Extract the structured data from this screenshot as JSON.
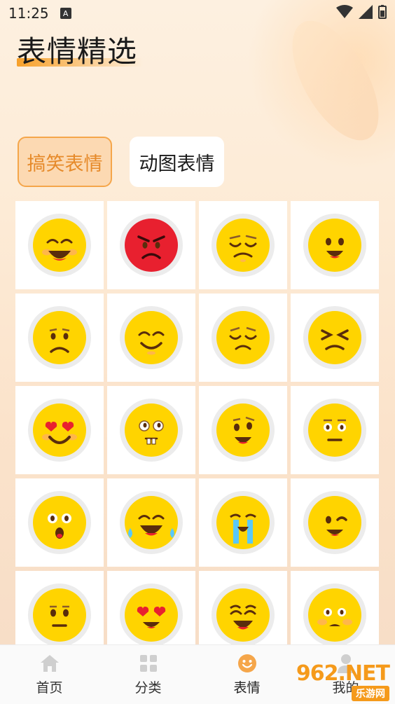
{
  "status_bar": {
    "time": "11:25",
    "notification_icon": "A"
  },
  "page": {
    "title": "表情精选"
  },
  "tabs": [
    {
      "label": "搞笑表情",
      "active": true
    },
    {
      "label": "动图表情",
      "active": false
    }
  ],
  "emojis": [
    "grinning-blush",
    "angry-red",
    "annoyed",
    "happy-open",
    "sad",
    "content-smile",
    "worried",
    "squinting-upset",
    "heart-eyes-grin",
    "buck-tooth",
    "smirk-grin",
    "neutral-raised",
    "surprised",
    "tears-of-joy",
    "loudly-crying",
    "wink",
    "neutral",
    "heart-eyes",
    "big-grin",
    "flushed"
  ],
  "bottom_nav": [
    {
      "label": "首页",
      "icon": "home-icon"
    },
    {
      "label": "分类",
      "icon": "grid-icon"
    },
    {
      "label": "表情",
      "icon": "smile-icon",
      "active": true
    },
    {
      "label": "我的",
      "icon": "user-icon"
    }
  ],
  "watermark": {
    "top": "962.NET",
    "bottom": "乐游网"
  },
  "colors": {
    "accent": "#f5a64a",
    "emoji_yellow": "#ffd400",
    "angry_red": "#e8202f"
  }
}
